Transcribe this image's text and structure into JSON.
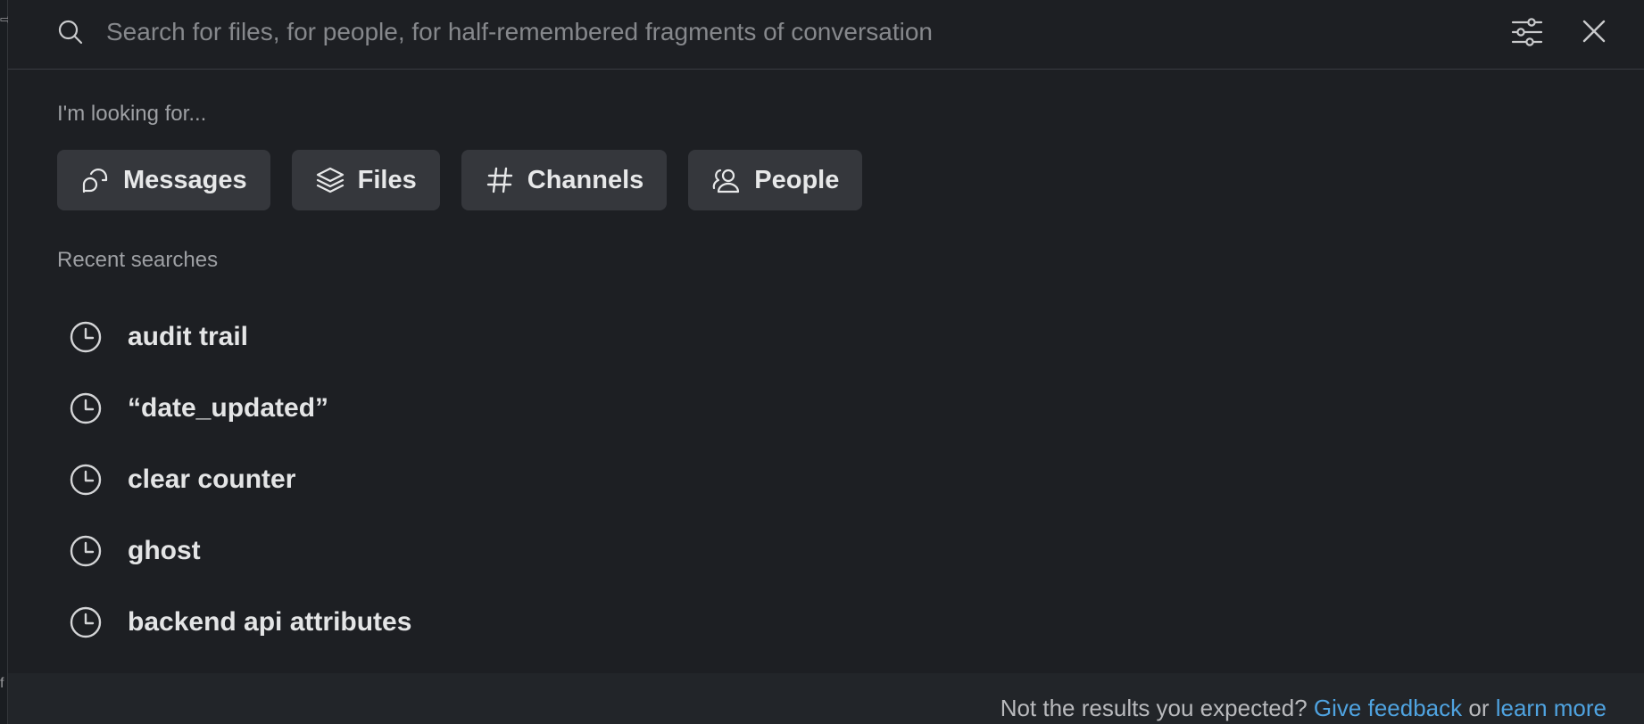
{
  "gutter": {
    "top_mark": "⇨",
    "bottom_mark": "f"
  },
  "search": {
    "placeholder": "Search for files, for people, for half-remembered fragments of conversation",
    "value": "",
    "icon": "search-icon",
    "filter_icon": "sliders-icon",
    "close_icon": "close-icon"
  },
  "looking_for": {
    "label": "I'm looking for...",
    "chips": [
      {
        "label": "Messages",
        "icon": "message-bubbles-icon"
      },
      {
        "label": "Files",
        "icon": "layers-icon"
      },
      {
        "label": "Channels",
        "icon": "hash-icon"
      },
      {
        "label": "People",
        "icon": "people-icon"
      }
    ]
  },
  "recent": {
    "label": "Recent searches",
    "items": [
      "audit trail",
      "“date_updated”",
      "clear counter",
      "ghost",
      "backend api attributes"
    ]
  },
  "footer": {
    "prefix": "Not the results you expected?",
    "feedback_link": "Give feedback",
    "middle": "or",
    "learn_link": "learn more"
  },
  "colors": {
    "background": "#1d1f23",
    "chip": "#35373c",
    "link": "#4fa3e0",
    "muted_text": "#9ea0a4"
  }
}
